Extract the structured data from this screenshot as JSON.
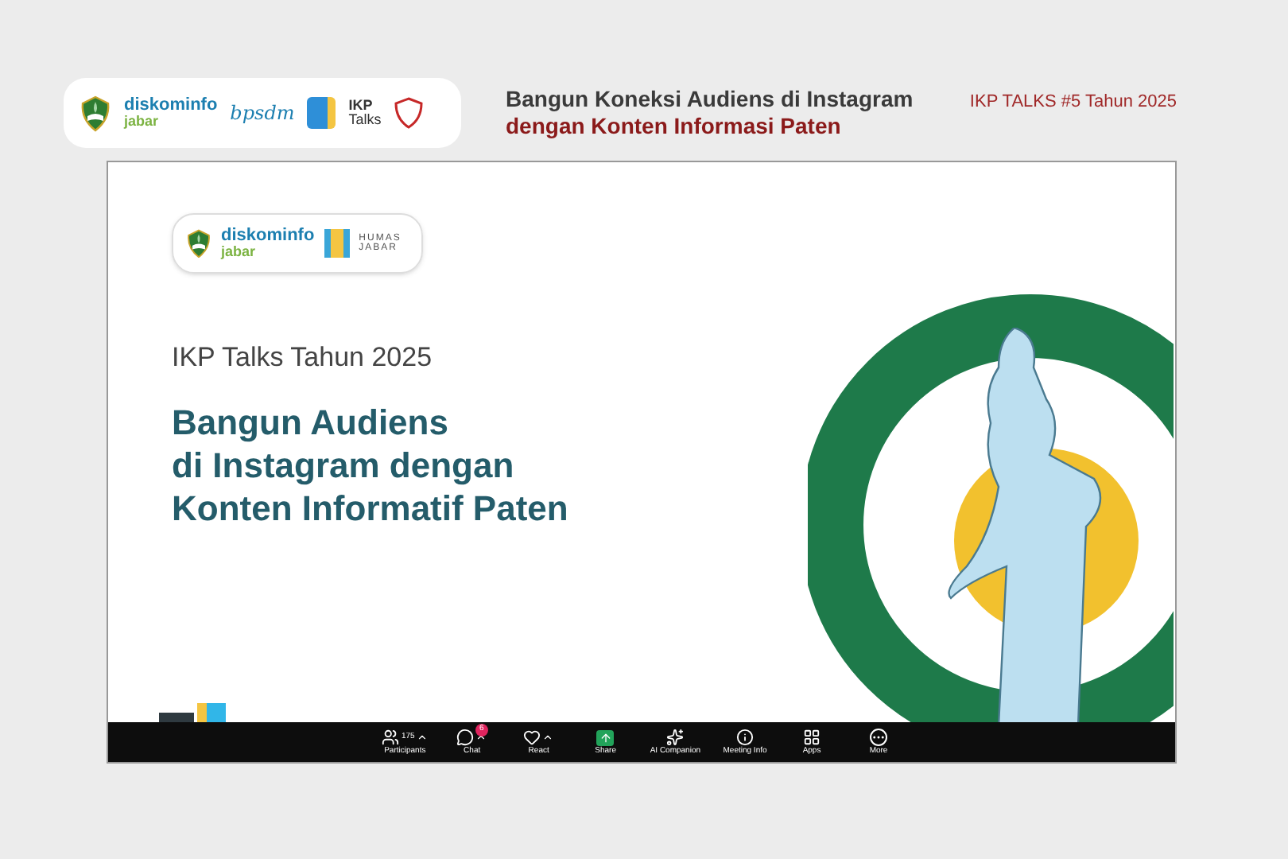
{
  "header": {
    "logo_strip": {
      "diskominfo": {
        "line_1": "diskominfo",
        "line_2": "jabar"
      },
      "bpsdm": "bpsdm",
      "ikp": {
        "line_1": "IKP",
        "line_2": "Talks"
      }
    },
    "title_line_1": "Bangun Koneksi Audiens di Instagram",
    "title_line_2": "dengan Konten Informasi Paten",
    "event": "IKP TALKS #5 Tahun 2025"
  },
  "slide": {
    "logo_strip": {
      "diskominfo": {
        "line_1": "diskominfo",
        "line_2": "jabar"
      },
      "humas": {
        "line_1": "HUMAS",
        "line_2": "JABAR"
      }
    },
    "subtitle": "IKP Talks Tahun 2025",
    "title_lines": [
      "Bangun Audiens",
      "di Instagram dengan",
      "Konten Informatif Paten"
    ]
  },
  "toolbar": [
    {
      "kind": "participants",
      "label": "Participants",
      "count": "175",
      "caret": true
    },
    {
      "kind": "chat",
      "label": "Chat",
      "badge": "6",
      "caret": true
    },
    {
      "kind": "react",
      "label": "React",
      "caret": true
    },
    {
      "kind": "share",
      "label": "Share",
      "caret": false
    },
    {
      "kind": "ai",
      "label": "AI Companion",
      "caret": false
    },
    {
      "kind": "info",
      "label": "Meeting Info",
      "caret": false
    },
    {
      "kind": "apps",
      "label": "Apps",
      "caret": false
    },
    {
      "kind": "more",
      "label": "More",
      "caret": false
    }
  ]
}
